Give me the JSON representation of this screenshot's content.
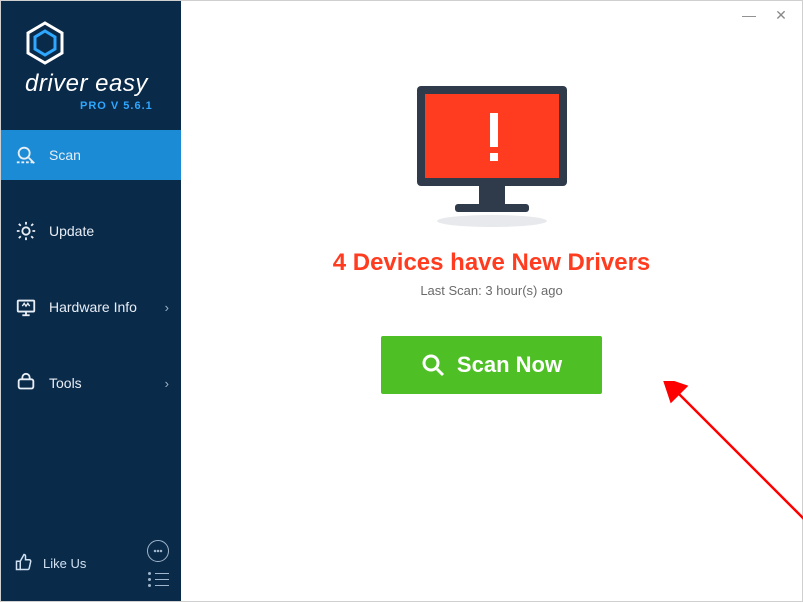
{
  "brand": {
    "name": "driver easy",
    "version_label": "PRO V 5.6.1"
  },
  "sidebar": {
    "items": [
      {
        "label": "Scan",
        "icon": "scan-icon",
        "has_submenu": false,
        "active": true
      },
      {
        "label": "Update",
        "icon": "update-icon",
        "has_submenu": false,
        "active": false
      },
      {
        "label": "Hardware Info",
        "icon": "hardware-info-icon",
        "has_submenu": true,
        "active": false
      },
      {
        "label": "Tools",
        "icon": "tools-icon",
        "has_submenu": true,
        "active": false
      }
    ],
    "footer": {
      "like_label": "Like Us",
      "feedback_icon": "feedback-icon",
      "menu_icon": "menu-icon"
    }
  },
  "window": {
    "minimize_glyph": "—",
    "close_glyph": "✕"
  },
  "main": {
    "headline": "4 Devices have New Drivers",
    "last_scan_label": "Last Scan: 3 hour(s) ago",
    "scan_button_label": "Scan Now"
  },
  "colors": {
    "sidebar_bg": "#0a2a4a",
    "sidebar_active": "#1b8bd6",
    "accent_blue": "#2ea7ff",
    "alert_red": "#ff3c1f",
    "scan_green": "#4fbf26",
    "monitor_frame": "#2f3a4a"
  }
}
